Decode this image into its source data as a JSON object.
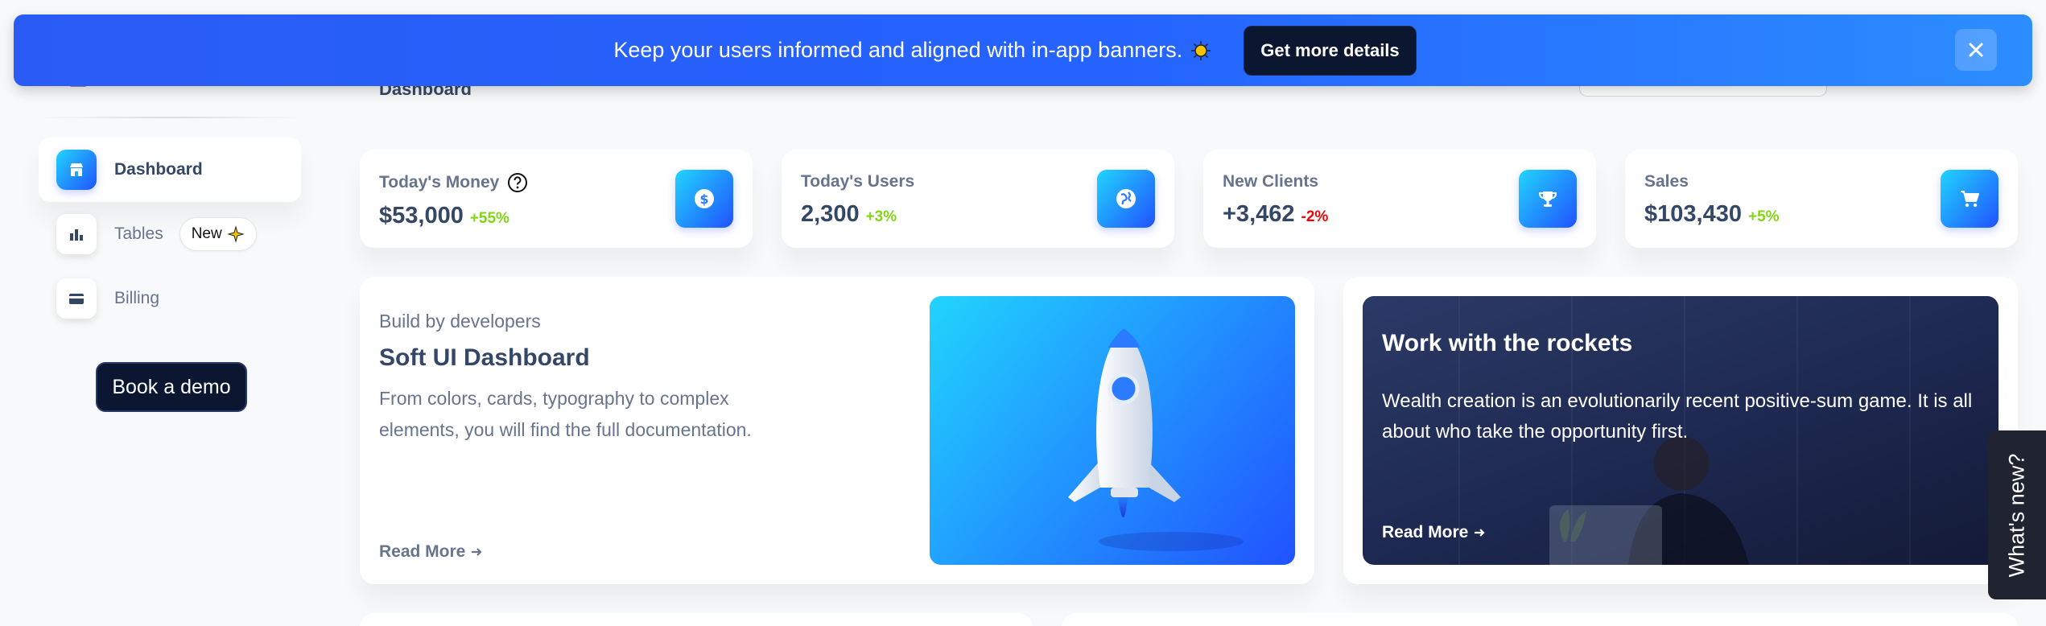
{
  "sidebar": {
    "items": [
      {
        "label": "Dashboard",
        "icon": "shop-icon",
        "active": true
      },
      {
        "label": "Tables",
        "icon": "chart-bar-icon",
        "badge": "New"
      },
      {
        "label": "Billing",
        "icon": "credit-card-icon"
      }
    ],
    "demo_button": "Book a demo"
  },
  "header": {
    "page_title": "Dashboard"
  },
  "banner": {
    "text": "Keep your users informed and aligned with in-app banners.",
    "icon": "sun-icon",
    "button": "Get more details",
    "close_icon": "close-icon"
  },
  "stats": [
    {
      "label": "Today's Money",
      "value": "$53,000",
      "change": "+55%",
      "trend": "positive",
      "icon": "dollar-icon",
      "help_icon": true
    },
    {
      "label": "Today's Users",
      "value": "2,300",
      "change": "+3%",
      "trend": "positive",
      "icon": "globe-icon"
    },
    {
      "label": "New Clients",
      "value": "+3,462",
      "change": "-2%",
      "trend": "negative",
      "icon": "trophy-icon"
    },
    {
      "label": "Sales",
      "value": "$103,430",
      "change": "+5%",
      "trend": "positive",
      "icon": "cart-icon"
    }
  ],
  "build_card": {
    "subtitle": "Build by developers",
    "title": "Soft UI Dashboard",
    "description": "From colors, cards, typography to complex elements, you will find the full documentation.",
    "read_more": "Read More"
  },
  "rockets_card": {
    "title": "Work with the rockets",
    "description": "Wealth creation is an evolutionarily recent positive-sum game. It is all about who take the opportunity first.",
    "read_more": "Read More"
  },
  "whats_new": "What's new?",
  "colors": {
    "accent_gradient_start": "#2152ff",
    "accent_gradient_end": "#21d4fd",
    "banner": "#2563ff",
    "positive": "#82d616",
    "negative": "#ea0606",
    "dark_button": "#0b1631"
  }
}
